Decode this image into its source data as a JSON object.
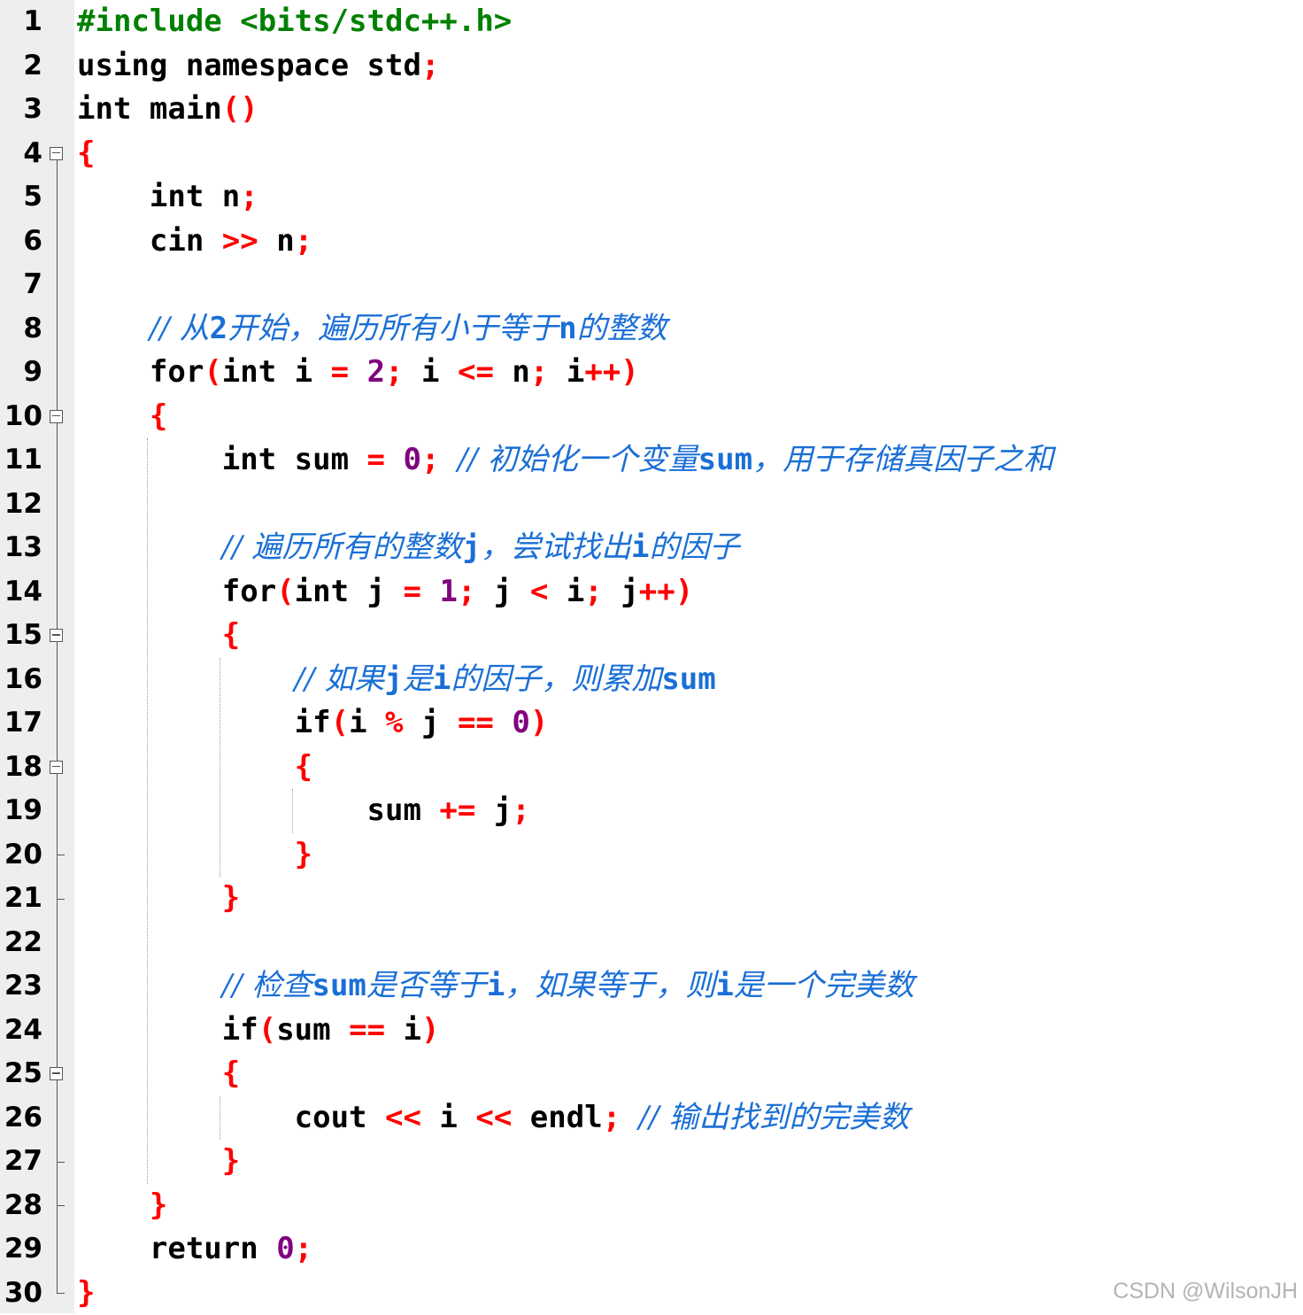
{
  "watermark": "CSDN @WilsonJH",
  "lines": [
    {
      "n": "1",
      "tokens": [
        [
          "pre",
          "#include <bits/stdc++.h>"
        ]
      ]
    },
    {
      "n": "2",
      "tokens": [
        [
          "kw",
          "using namespace std"
        ],
        [
          "p",
          ";"
        ]
      ]
    },
    {
      "n": "3",
      "tokens": [
        [
          "kw",
          "int main"
        ],
        [
          "p",
          "()"
        ]
      ]
    },
    {
      "n": "4",
      "tokens": [
        [
          "p",
          "{"
        ]
      ]
    },
    {
      "n": "5",
      "tokens": [
        [
          "sp",
          "    "
        ],
        [
          "kw",
          "int n"
        ],
        [
          "p",
          ";"
        ]
      ]
    },
    {
      "n": "6",
      "tokens": [
        [
          "sp",
          "    "
        ],
        [
          "kw",
          "cin "
        ],
        [
          "op",
          ">>"
        ],
        [
          "kw",
          " n"
        ],
        [
          "p",
          ";"
        ]
      ]
    },
    {
      "n": "7",
      "tokens": []
    },
    {
      "n": "8",
      "tokens": [
        [
          "sp",
          "    "
        ],
        [
          "com",
          "// 从2开始，遍历所有小于等于n的整数"
        ]
      ]
    },
    {
      "n": "9",
      "tokens": [
        [
          "sp",
          "    "
        ],
        [
          "kw",
          "for"
        ],
        [
          "p",
          "("
        ],
        [
          "kw",
          "int i "
        ],
        [
          "op",
          "="
        ],
        [
          "kw",
          " "
        ],
        [
          "num",
          "2"
        ],
        [
          "p",
          ";"
        ],
        [
          "kw",
          " i "
        ],
        [
          "op",
          "<="
        ],
        [
          "kw",
          " n"
        ],
        [
          "p",
          ";"
        ],
        [
          "kw",
          " i"
        ],
        [
          "op",
          "++"
        ],
        [
          "p",
          ")"
        ]
      ]
    },
    {
      "n": "10",
      "tokens": [
        [
          "sp",
          "    "
        ],
        [
          "p",
          "{"
        ]
      ]
    },
    {
      "n": "11",
      "tokens": [
        [
          "sp",
          "        "
        ],
        [
          "kw",
          "int sum "
        ],
        [
          "op",
          "="
        ],
        [
          "kw",
          " "
        ],
        [
          "num",
          "0"
        ],
        [
          "p",
          ";"
        ],
        [
          "kw",
          " "
        ],
        [
          "com",
          "// 初始化一个变量sum，用于存储真因子之和"
        ]
      ]
    },
    {
      "n": "12",
      "tokens": []
    },
    {
      "n": "13",
      "tokens": [
        [
          "sp",
          "        "
        ],
        [
          "com",
          "// 遍历所有的整数j，尝试找出i的因子"
        ]
      ]
    },
    {
      "n": "14",
      "tokens": [
        [
          "sp",
          "        "
        ],
        [
          "kw",
          "for"
        ],
        [
          "p",
          "("
        ],
        [
          "kw",
          "int j "
        ],
        [
          "op",
          "="
        ],
        [
          "kw",
          " "
        ],
        [
          "num",
          "1"
        ],
        [
          "p",
          ";"
        ],
        [
          "kw",
          " j "
        ],
        [
          "op",
          "<"
        ],
        [
          "kw",
          " i"
        ],
        [
          "p",
          ";"
        ],
        [
          "kw",
          " j"
        ],
        [
          "op",
          "++"
        ],
        [
          "p",
          ")"
        ]
      ]
    },
    {
      "n": "15",
      "tokens": [
        [
          "sp",
          "        "
        ],
        [
          "p",
          "{"
        ]
      ]
    },
    {
      "n": "16",
      "tokens": [
        [
          "sp",
          "            "
        ],
        [
          "com",
          "// 如果j是i的因子，则累加sum"
        ]
      ]
    },
    {
      "n": "17",
      "tokens": [
        [
          "sp",
          "            "
        ],
        [
          "kw",
          "if"
        ],
        [
          "p",
          "("
        ],
        [
          "kw",
          "i "
        ],
        [
          "op",
          "%"
        ],
        [
          "kw",
          " j "
        ],
        [
          "op",
          "=="
        ],
        [
          "kw",
          " "
        ],
        [
          "num",
          "0"
        ],
        [
          "p",
          ")"
        ]
      ]
    },
    {
      "n": "18",
      "tokens": [
        [
          "sp",
          "            "
        ],
        [
          "p",
          "{"
        ]
      ]
    },
    {
      "n": "19",
      "tokens": [
        [
          "sp",
          "                "
        ],
        [
          "kw",
          "sum "
        ],
        [
          "op",
          "+="
        ],
        [
          "kw",
          " j"
        ],
        [
          "p",
          ";"
        ]
      ]
    },
    {
      "n": "20",
      "tokens": [
        [
          "sp",
          "            "
        ],
        [
          "p",
          "}"
        ]
      ]
    },
    {
      "n": "21",
      "tokens": [
        [
          "sp",
          "        "
        ],
        [
          "p",
          "}"
        ]
      ]
    },
    {
      "n": "22",
      "tokens": []
    },
    {
      "n": "23",
      "tokens": [
        [
          "sp",
          "        "
        ],
        [
          "com",
          "// 检查sum是否等于i，如果等于，则i是一个完美数"
        ]
      ]
    },
    {
      "n": "24",
      "tokens": [
        [
          "sp",
          "        "
        ],
        [
          "kw",
          "if"
        ],
        [
          "p",
          "("
        ],
        [
          "kw",
          "sum "
        ],
        [
          "op",
          "=="
        ],
        [
          "kw",
          " i"
        ],
        [
          "p",
          ")"
        ]
      ]
    },
    {
      "n": "25",
      "tokens": [
        [
          "sp",
          "        "
        ],
        [
          "p",
          "{"
        ]
      ]
    },
    {
      "n": "26",
      "tokens": [
        [
          "sp",
          "            "
        ],
        [
          "kw",
          "cout "
        ],
        [
          "op",
          "<<"
        ],
        [
          "kw",
          " i "
        ],
        [
          "op",
          "<<"
        ],
        [
          "kw",
          " endl"
        ],
        [
          "p",
          ";"
        ],
        [
          "kw",
          " "
        ],
        [
          "com",
          "// 输出找到的完美数"
        ]
      ]
    },
    {
      "n": "27",
      "tokens": [
        [
          "sp",
          "        "
        ],
        [
          "p",
          "}"
        ]
      ]
    },
    {
      "n": "28",
      "tokens": [
        [
          "sp",
          "    "
        ],
        [
          "p",
          "}"
        ]
      ]
    },
    {
      "n": "29",
      "tokens": [
        [
          "sp",
          "    "
        ],
        [
          "kw",
          "return "
        ],
        [
          "num",
          "0"
        ],
        [
          "p",
          ";"
        ]
      ]
    },
    {
      "n": "30",
      "tokens": [
        [
          "p",
          "}"
        ]
      ]
    }
  ],
  "folds": [
    {
      "start": "4",
      "end": "30"
    },
    {
      "start": "10",
      "end": "28"
    },
    {
      "start": "15",
      "end": "21"
    },
    {
      "start": "18",
      "end": "20"
    },
    {
      "start": "25",
      "end": "27"
    }
  ]
}
